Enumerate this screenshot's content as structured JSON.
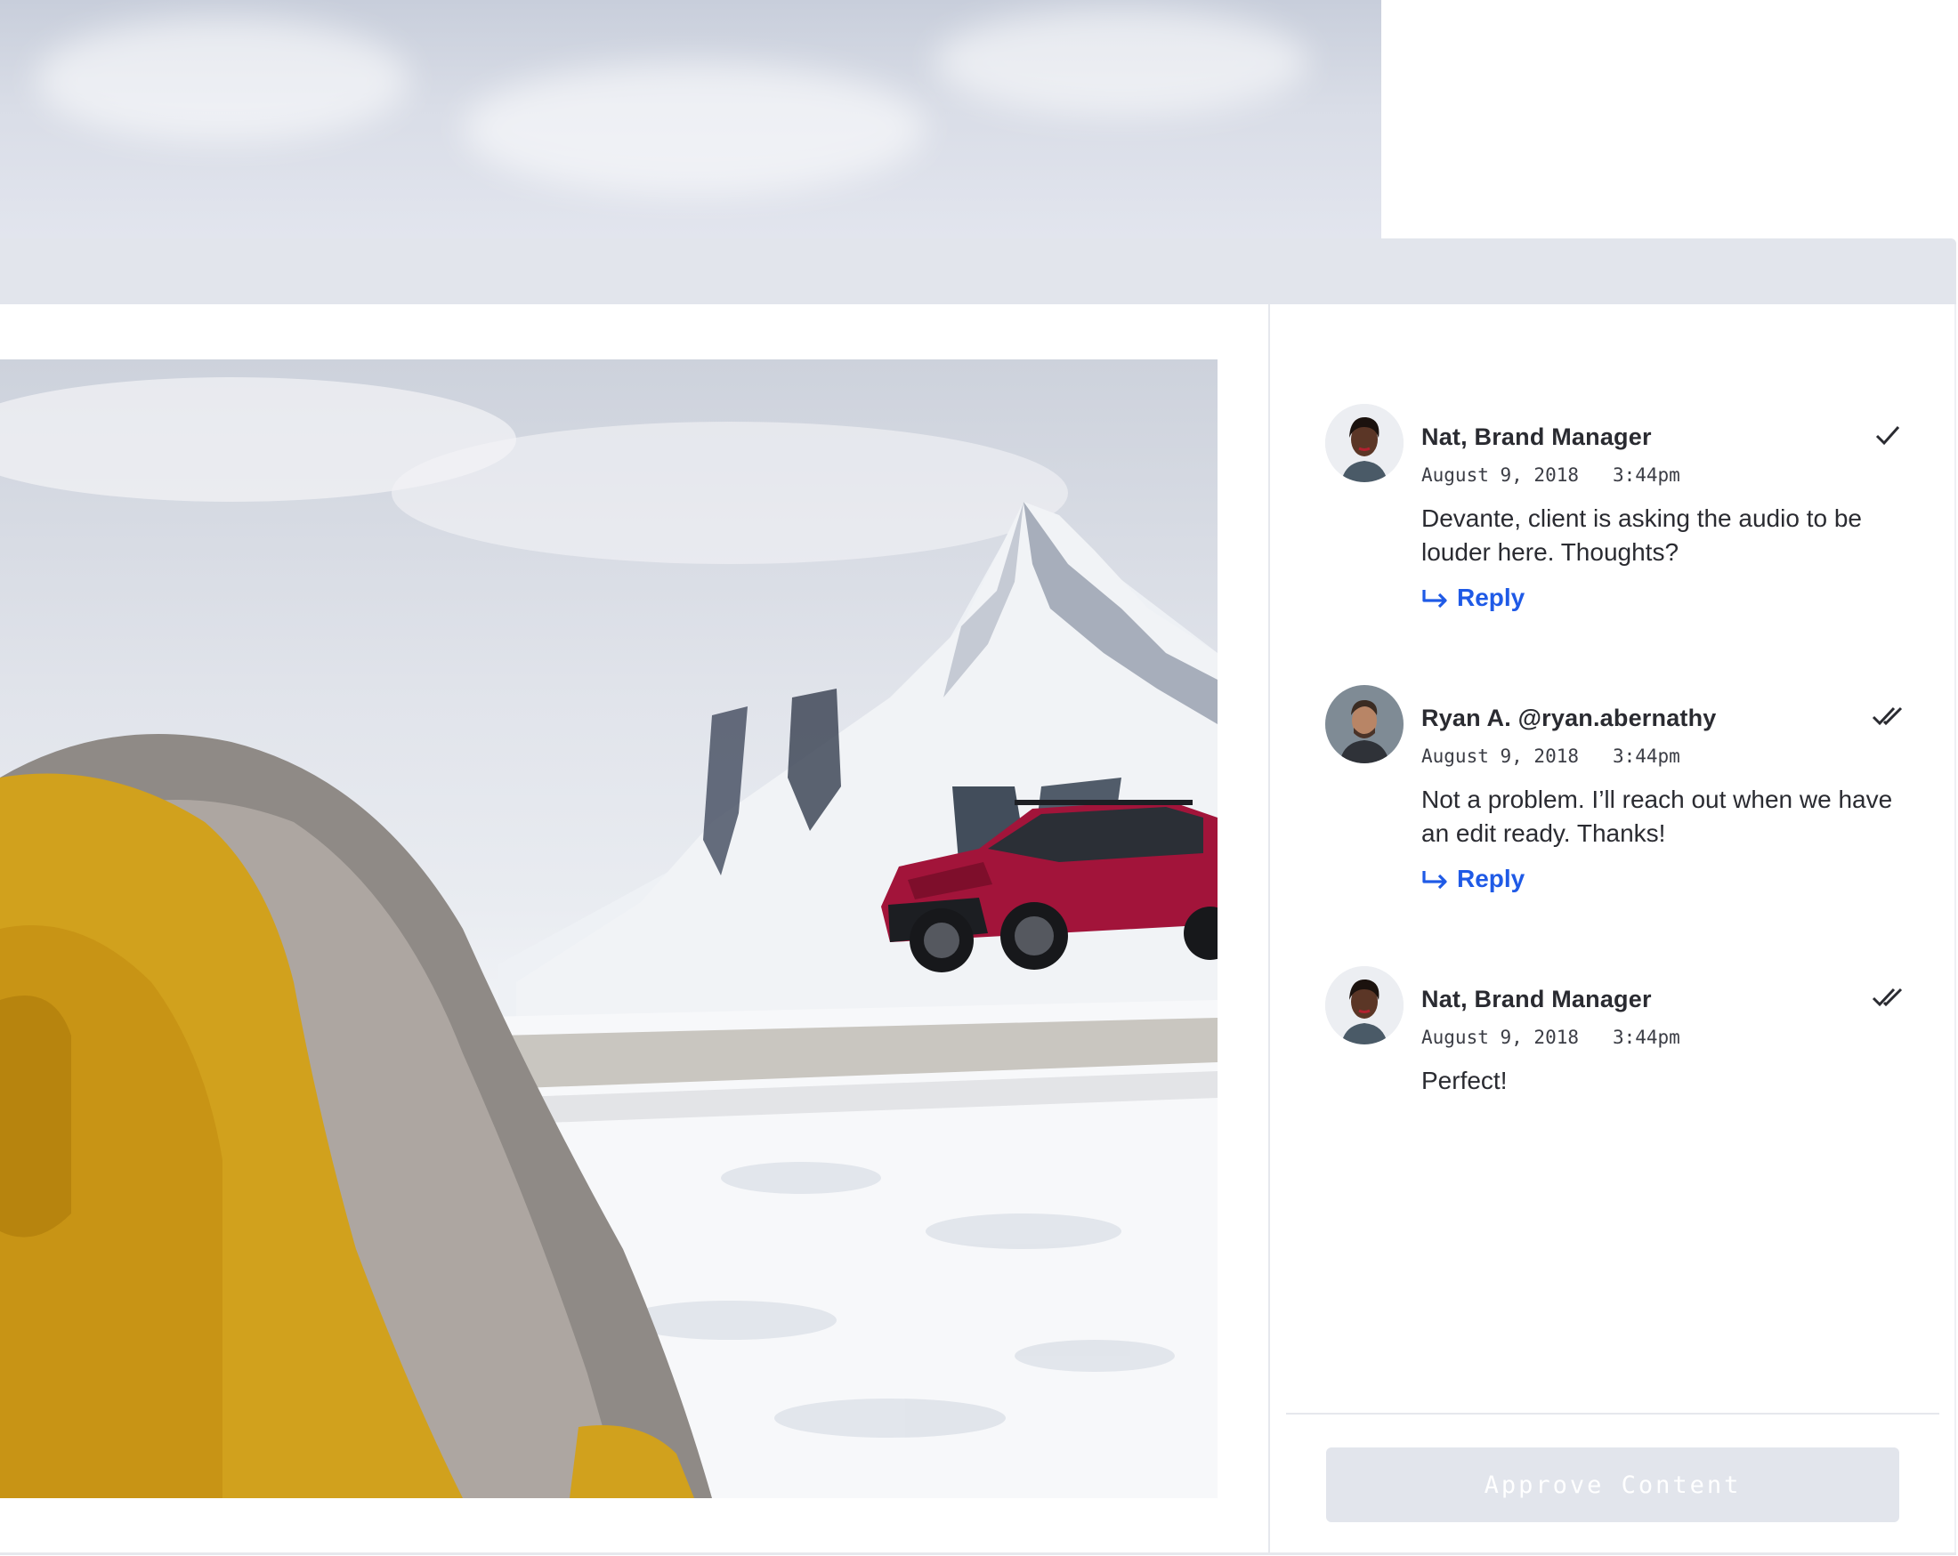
{
  "comments": [
    {
      "author": "Nat, Brand Manager",
      "date": "August 9, 2018",
      "time": "3:44pm",
      "text": "Devante, client is asking the audio to be louder here. Thoughts?",
      "reply_label": "Reply",
      "status_icon": "check-icon"
    },
    {
      "author": "Ryan A. @ryan.abernathy",
      "date": "August 9, 2018",
      "time": "3:44pm",
      "text": "Not a problem. I’ll reach out when we have an edit ready. Thanks!",
      "reply_label": "Reply",
      "status_icon": "double-check-icon"
    },
    {
      "author": "Nat, Brand Manager",
      "date": "August 9, 2018",
      "time": "3:44pm",
      "text": "Perfect!",
      "status_icon": "double-check-icon"
    }
  ],
  "approve_label": "Approve Content",
  "colors": {
    "accent": "#1f5ae6",
    "titlebar": "#e2e5ec",
    "text": "#2a2b31",
    "approve_bg": "#e2e5ec"
  }
}
